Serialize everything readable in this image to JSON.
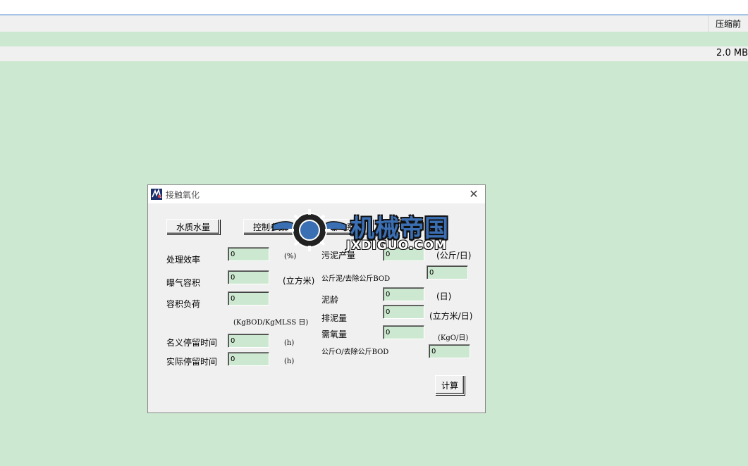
{
  "header": {
    "compress_label": "压缩前",
    "size_label": "2.0 MB"
  },
  "dialog": {
    "title": "接触氧化",
    "close_glyph": "✕",
    "buttons": {
      "water": "水质水量",
      "control": "控制参数",
      "aeration": "曝气系统",
      "calc": "计算"
    },
    "left": {
      "efficiency": {
        "label": "处理效率",
        "value": "0",
        "unit": "(%)"
      },
      "aeration_volume": {
        "label": "曝气容积",
        "value": "0",
        "unit": "(立方米)"
      },
      "volume_load": {
        "label": "容积负荷",
        "value": "0",
        "unit": "(KgBOD/KgMLSS 日)"
      },
      "nominal_hrt": {
        "label": "名义停留时间",
        "value": "0",
        "unit": "(h)"
      },
      "actual_hrt": {
        "label": "实际停留时间",
        "value": "0",
        "unit": "(h)"
      }
    },
    "right": {
      "sludge_production": {
        "label": "污泥产量",
        "value": "0",
        "unit": "(公斤/日)"
      },
      "sludge_per_bod": {
        "label": "公斤泥/去除公斤BOD",
        "value": "0"
      },
      "sludge_age": {
        "label": "泥龄",
        "value": "0",
        "unit": "(日)"
      },
      "sludge_discharge": {
        "label": "排泥量",
        "value": "0",
        "unit": "(立方米/日)"
      },
      "oxygen_demand": {
        "label": "需氧量",
        "value": "0",
        "unit": "(KgO/日)"
      },
      "o2_per_bod": {
        "label": "公斤O/去除公斤BOD",
        "value": "0"
      }
    }
  },
  "watermark": {
    "text": "机械帝国",
    "sub": "JXDIGUO.COM"
  },
  "colors": {
    "background": "#cde8d0",
    "dialog": "#f0f0f0",
    "field": "#cde8d0",
    "watermark_blue": "#3b6fb3"
  }
}
